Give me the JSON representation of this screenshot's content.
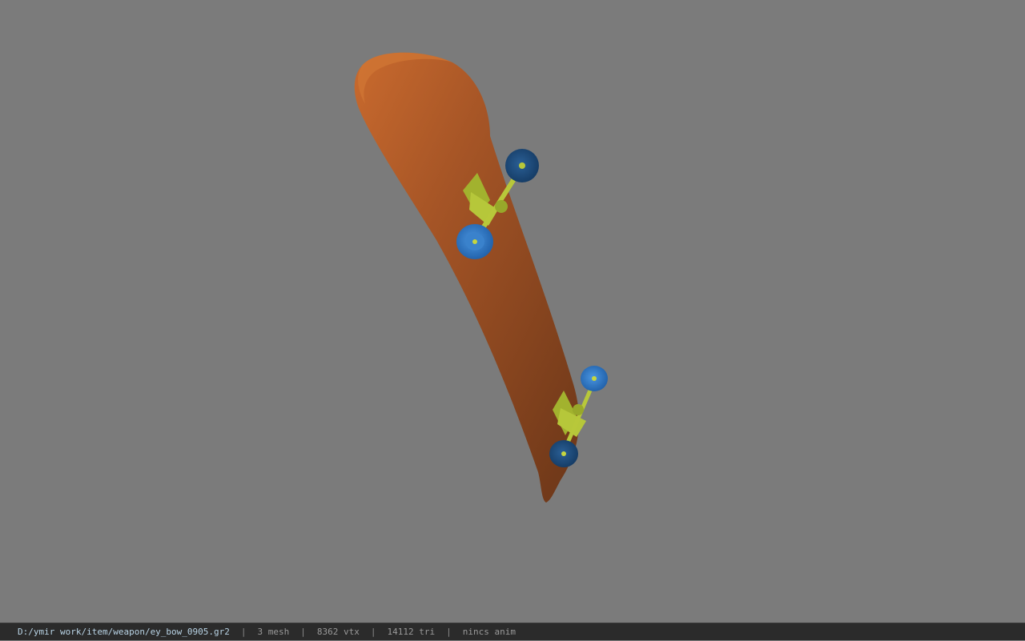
{
  "viewer": {
    "background_color": "#7b7b7b",
    "model": {
      "deck_color": "#8a4a22",
      "deck_highlight_color": "#c0682c",
      "truck_color": "#a8b832",
      "wheel_color": "#2a6fb8",
      "wheel_dark_color": "#1b4a7a"
    }
  },
  "statusbar": {
    "file_path": "D:/ymir work/item/weapon/ey_bow_0905.gr2",
    "mesh_count": "3 mesh",
    "vertex_count": "8362 vtx",
    "triangle_count": "14112 tri",
    "anim_status": "nincs anim",
    "separator": "|"
  }
}
